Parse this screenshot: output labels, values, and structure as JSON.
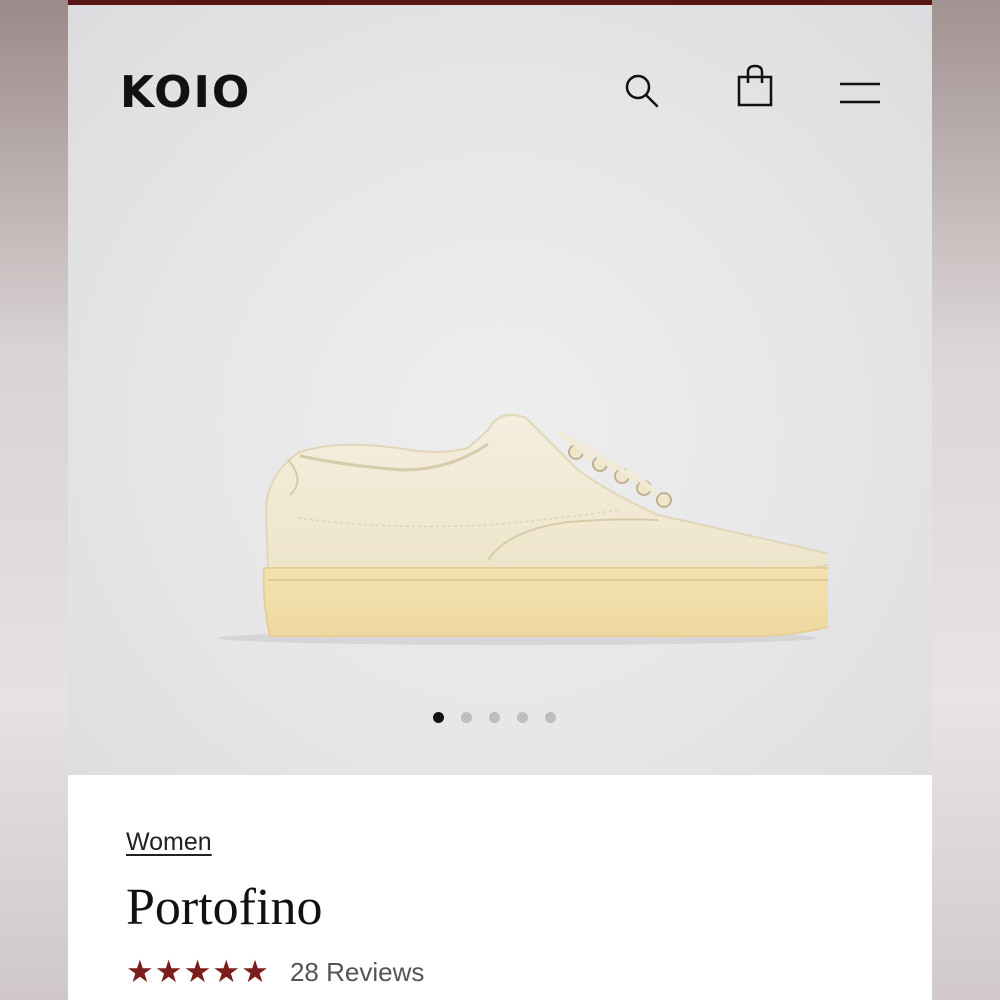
{
  "brand": {
    "logo_text": "KOIO",
    "accent_color": "#5a1414"
  },
  "header": {
    "icons": [
      "search-icon",
      "shopping-bag-icon",
      "menu-icon"
    ]
  },
  "gallery": {
    "image_count": 5,
    "active_index": 0
  },
  "product": {
    "breadcrumb": "Women",
    "title": "Portofino",
    "rating_stars": "★★★★★",
    "rating": 5,
    "reviews_text": "28 Reviews",
    "star_color": "#7c1d1d"
  }
}
